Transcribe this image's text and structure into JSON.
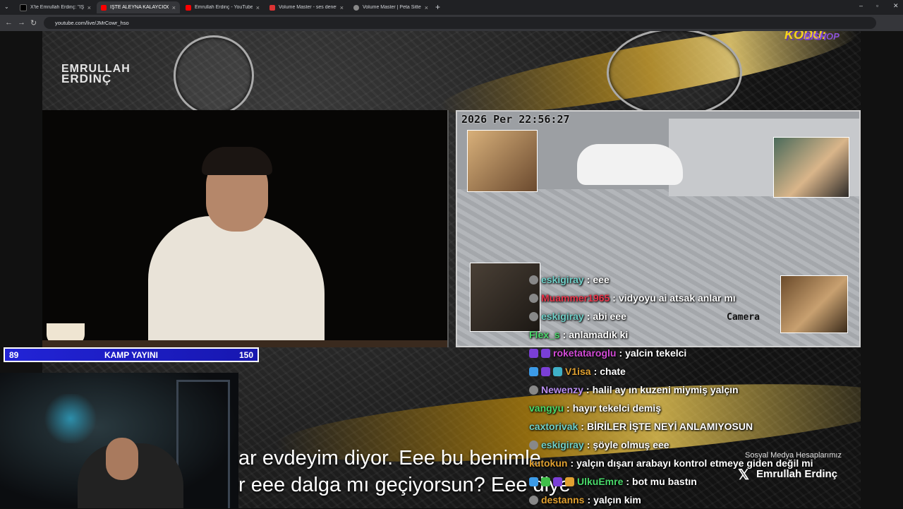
{
  "browser": {
    "tabs": [
      {
        "title": "X'te Emrullah Erdinç: \"İŞTE ALE",
        "fav": "#000000",
        "icon": "x-icon"
      },
      {
        "title": "İŞTE ALEYNA KALAYCIOĞL",
        "fav": "#ff0000",
        "icon": "youtube-icon"
      },
      {
        "title": "Emrullah Erdinç - YouTube",
        "fav": "#ff0000",
        "icon": "youtube-icon"
      },
      {
        "title": "Volume Master - ses denetleyic",
        "fav": "#d33",
        "icon": "extension-icon"
      },
      {
        "title": "Volume Master | Peta Sittek",
        "fav": "#888",
        "icon": "globe-icon"
      }
    ],
    "url": "youtube.com/live/JMrCowr_hso"
  },
  "video": {
    "brand_line1": "EMRULLAH",
    "brand_line2": "ERDINÇ",
    "cctv_timestamp": "2026 Per 22:56:27",
    "cctv_camera": "Camera",
    "score": {
      "left": "89",
      "title": "KAMP YAYINI",
      "right": "150"
    },
    "subtitle_line1": "ar evdeyim diyor. Eee bu benimle",
    "subtitle_line2": "r eee dalga mı geçiyorsun? Eee diye",
    "promo_line1": "İNDİRİM KODU:",
    "promo_line2": "BİSHOP",
    "social_header": "Sosyal Medya Hesaplarımız",
    "social_name": "Emrullah Erdinç"
  },
  "chat": [
    {
      "user": "eskigiray",
      "color": "#6fd0c8",
      "text": "eee",
      "badges": [
        "#888"
      ]
    },
    {
      "user": "Muammer1965",
      "color": "#e8344a",
      "text": "vidyoyu ai atsak anlar mı",
      "badges": [
        "#888"
      ]
    },
    {
      "user": "eskigiray",
      "color": "#6fd0c8",
      "text": "abi eee",
      "badges": [
        "#888"
      ]
    },
    {
      "user": "Flex_s",
      "color": "#49d96a",
      "text": "anlamadık ki",
      "badges": []
    },
    {
      "user": "roketataroglu",
      "color": "#d24bd6",
      "text": "yalcin tekelci",
      "badges": [
        "#7a3fd6",
        "#7a3fd6"
      ]
    },
    {
      "user": "V1isa",
      "color": "#e0a030",
      "text": "chate",
      "badges": [
        "#3c9be8",
        "#7a3fd6",
        "#3fb0c8"
      ]
    },
    {
      "user": "Newenzy",
      "color": "#b98ff0",
      "text": "halil ay ın kuzeni miymiş yalçın",
      "badges": [
        "#888"
      ]
    },
    {
      "user": "vangyu",
      "color": "#49d96a",
      "text": "hayır tekelci demiş",
      "badges": []
    },
    {
      "user": "caxtorivak",
      "color": "#6fd0c8",
      "text": "BİRİLER İŞTE NEYİ ANLAMIYOSUN",
      "badges": []
    },
    {
      "user": "eskigiray",
      "color": "#6fd0c8",
      "text": "şöyle olmuş eee",
      "badges": [
        "#888"
      ]
    },
    {
      "user": "kutokun",
      "color": "#e0a030",
      "text": "yalçın dışarı arabayı kontrol etmeye giden değil mi",
      "badges": []
    },
    {
      "user": "UlkuEmre",
      "color": "#49d96a",
      "text": "bot mu bastın",
      "badges": [
        "#3c9be8",
        "#3fbf4a",
        "#7a3fd6",
        "#e0a030"
      ]
    },
    {
      "user": "destanns",
      "color": "#e0a030",
      "text": "yalçın kim",
      "badges": [
        "#888"
      ]
    }
  ]
}
